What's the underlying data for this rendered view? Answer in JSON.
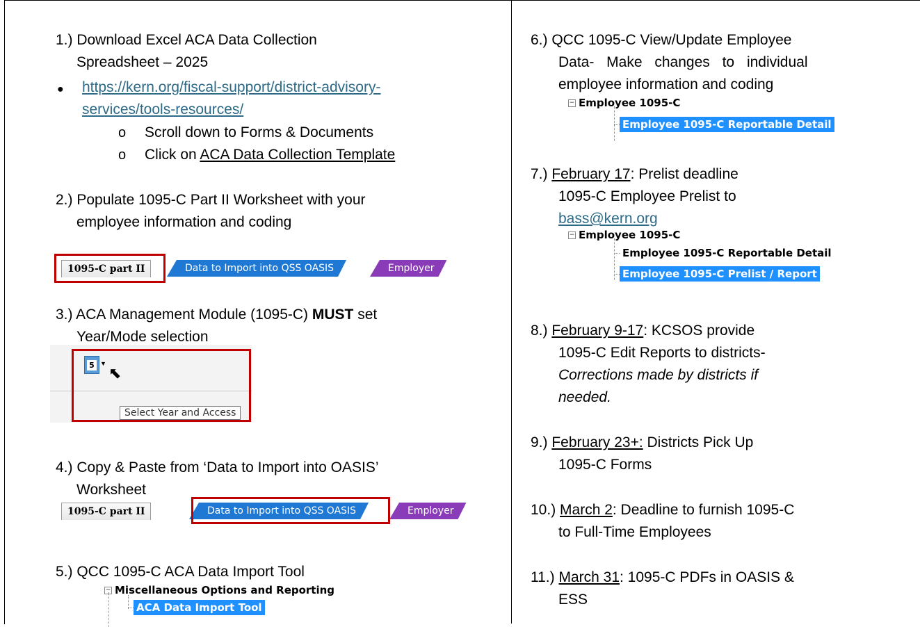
{
  "left": {
    "s1_line1": "1.) Download Excel ACA Data Collection",
    "s1_line2": "Spreadsheet – 2025",
    "s1_link_line1": "https://kern.org/fiscal-support/district-advisory-",
    "s1_link_line2": "services/tools-resources/",
    "s1_sub1": "Scroll down to Forms & Documents",
    "s1_sub2_prefix": "Click on ",
    "s1_sub2_link": "ACA Data Collection Template",
    "s2_line1": "2.) Populate 1095-C Part II Worksheet with your",
    "s2_line2": "employee information and coding",
    "tabs": {
      "tab1": "1095-C part II",
      "tab2": "Data to Import into QSS OASIS",
      "tab3": "Employer"
    },
    "s3_line1_prefix": "3.) ACA Management Module (1095-C) ",
    "s3_line1_bold": "MUST",
    "s3_line1_suffix": " set",
    "s3_line2": "Year/Mode selection",
    "year_icon_digit": "5",
    "tooltip": "Select Year and Access",
    "s4_line1": "4.) Copy & Paste from ‘Data to Import into OASIS’",
    "s4_line2": "Worksheet",
    "s5_line1": "5.) QCC 1095-C ACA Data Import Tool",
    "s5_tree_parent": "Miscellaneous Options and Reporting",
    "s5_tree_child": "ACA Data Import Tool"
  },
  "right": {
    "s6_line1": "6.) QCC 1095-C View/Update Employee",
    "s6_line2": "Data- Make changes to individual",
    "s6_line3": "employee information and coding",
    "s6_tree_parent": "Employee 1095-C",
    "s6_tree_child": "Employee 1095-C Reportable Detail",
    "s7_prefix": "7.) ",
    "s7_date": "February 17",
    "s7_rest": ": Prelist deadline",
    "s7_line2": "1095-C Employee Prelist to",
    "s7_email": "bass@kern.org",
    "s7_tree_parent": "Employee 1095-C",
    "s7_tree_child1": "Employee 1095-C Reportable Detail",
    "s7_tree_child2": "Employee 1095-C Prelist / Report",
    "s8_prefix": "8.) ",
    "s8_date": "February 9-17",
    "s8_rest": ": KCSOS provide",
    "s8_line2": "1095-C Edit Reports to districts-",
    "s8_line3": "Corrections made by districts if",
    "s8_line4": "needed.",
    "s9_prefix": "9.) ",
    "s9_date": "February 23+:",
    "s9_rest": " Districts Pick Up",
    "s9_line2": "1095-C Forms",
    "s10_prefix": "10.) ",
    "s10_date": "March 2",
    "s10_rest": ": Deadline to furnish 1095-C",
    "s10_line2": "to Full-Time Employees",
    "s11_prefix": "11.) ",
    "s11_date": "March 31",
    "s11_rest": ": 1095-C PDFs in OASIS &",
    "s11_line2": "ESS"
  }
}
